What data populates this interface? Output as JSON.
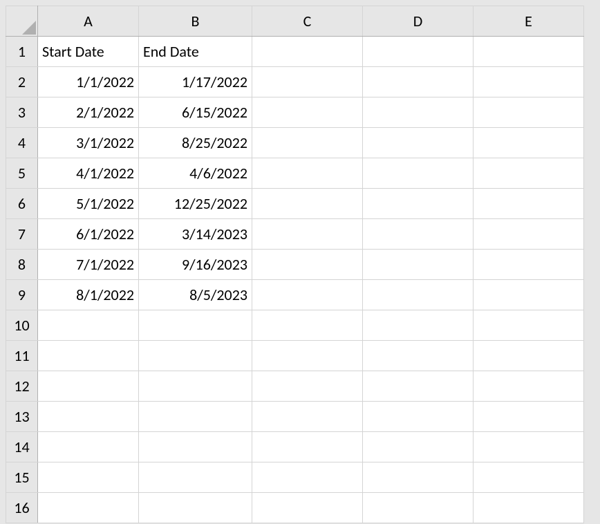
{
  "columns": [
    "A",
    "B",
    "C",
    "D",
    "E"
  ],
  "rowNumbers": [
    "1",
    "2",
    "3",
    "4",
    "5",
    "6",
    "7",
    "8",
    "9",
    "10",
    "11",
    "12",
    "13",
    "14",
    "15",
    "16"
  ],
  "headers": {
    "A": "Start Date",
    "B": "End Date"
  },
  "data": [
    {
      "A": "1/1/2022",
      "B": "1/17/2022"
    },
    {
      "A": "2/1/2022",
      "B": "6/15/2022"
    },
    {
      "A": "3/1/2022",
      "B": "8/25/2022"
    },
    {
      "A": "4/1/2022",
      "B": "4/6/2022"
    },
    {
      "A": "5/1/2022",
      "B": "12/25/2022"
    },
    {
      "A": "6/1/2022",
      "B": "3/14/2023"
    },
    {
      "A": "7/1/2022",
      "B": "9/16/2023"
    },
    {
      "A": "8/1/2022",
      "B": "8/5/2023"
    }
  ]
}
